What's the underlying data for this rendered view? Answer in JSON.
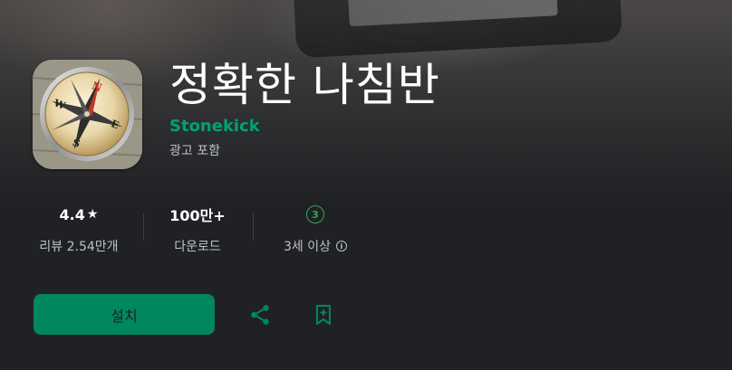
{
  "app": {
    "title": "정확한 나침반",
    "developer": "Stonekick",
    "ads_note": "광고 포함",
    "icon": "compass-app-icon"
  },
  "stats": {
    "rating": {
      "value": "4.4",
      "icon": "star-icon",
      "label": "리뷰 2.54만개"
    },
    "downloads": {
      "value": "100만+",
      "label": "다운로드"
    },
    "age": {
      "badge": "3",
      "label": "3세 이상",
      "icon": "info-icon"
    }
  },
  "actions": {
    "install_label": "설치",
    "share_icon": "share-icon",
    "wishlist_icon": "bookmark-add-icon"
  },
  "colors": {
    "background": "#202124",
    "accent": "#01875f",
    "developer_link": "#00a173",
    "age_badge": "#34a853"
  }
}
